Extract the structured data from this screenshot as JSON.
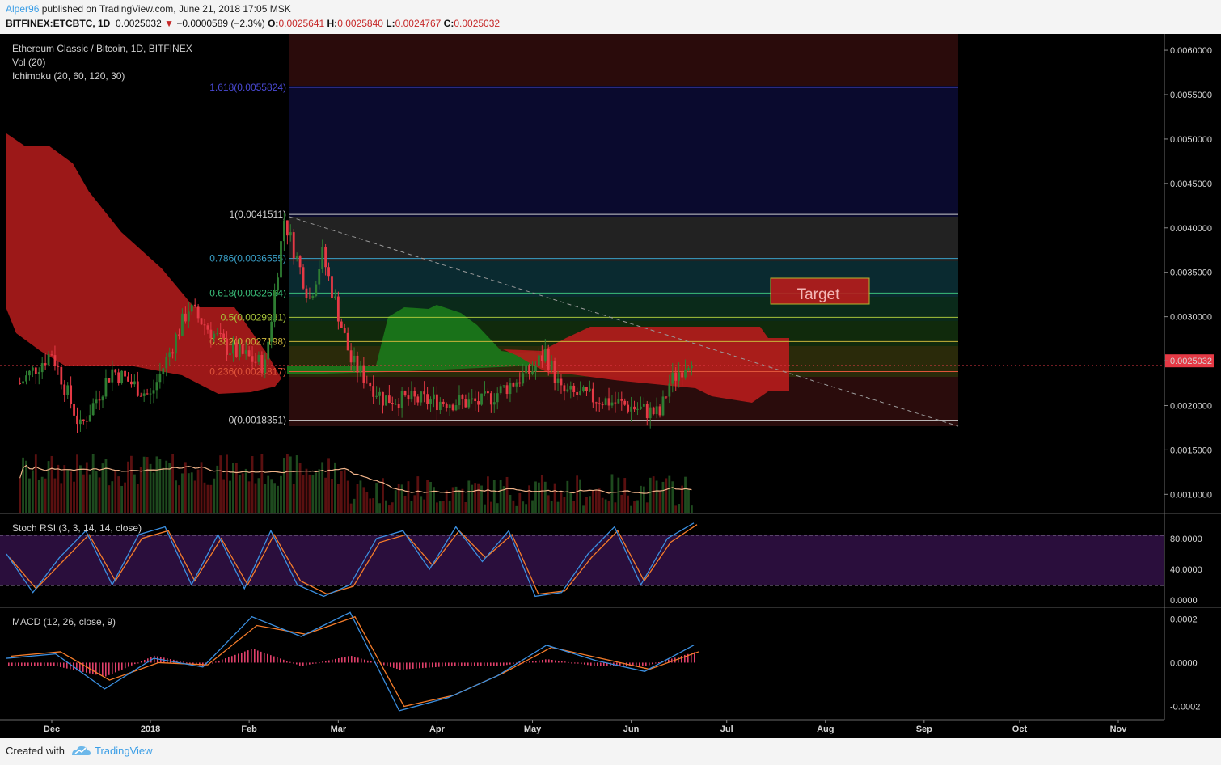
{
  "header": {
    "author": "Alper96",
    "published_text": "published on TradingView.com, June 21, 2018 17:05 MSK",
    "symbol": "BITFINEX:ETCBTC, 1D",
    "last": "0.0025032",
    "change": "−0.0000589 (−2.3%)",
    "o_label": "O:",
    "o": "0.0025641",
    "h_label": "H:",
    "h": "0.0025840",
    "l_label": "L:",
    "l": "0.0024767",
    "c_label": "C:",
    "c": "0.0025032"
  },
  "panes": {
    "main_title": "Ethereum Classic / Bitcoin, 1D, BITFINEX",
    "vol_label": "Vol (20)",
    "ichimoku_label": "Ichimoku (20, 60, 120, 30)",
    "stoch_label": "Stoch RSI (3, 3, 14, 14, close)",
    "macd_label": "MACD (12, 26, close, 9)"
  },
  "annotation": {
    "target_label": "Target"
  },
  "footer": {
    "created_with": "Created with",
    "brand": "TradingView"
  },
  "colors": {
    "background": "#000000",
    "up": "#2e7d32",
    "down": "#e53945",
    "fib_line": "#dcdcdc",
    "cloud_bear": "#b71c1c",
    "cloud_bull": "#1b7a1b",
    "stoch_k": "#3b8fe0",
    "stoch_d": "#f57c2a",
    "macd_line": "#3b8fe0",
    "signal_line": "#f57c2a",
    "current_price_tag": "#e53945"
  },
  "chart_data": [
    {
      "type": "candlestick",
      "title": "Ethereum Classic / Bitcoin, 1D, BITFINEX",
      "x_ticks": [
        "Dec",
        "2018",
        "Feb",
        "Mar",
        "Apr",
        "May",
        "Jun",
        "Jul",
        "Aug",
        "Sep",
        "Oct",
        "Nov"
      ],
      "y_ticks": [
        "0.0060000",
        "0.0055000",
        "0.0050000",
        "0.0045000",
        "0.0040000",
        "0.0035000",
        "0.0030000",
        "0.0025032",
        "0.0020000",
        "0.0015000",
        "0.0010000"
      ],
      "ylim": [
        0.00083,
        0.00611
      ],
      "current_price": 0.0025032,
      "fib_retracement": [
        {
          "label": "1.618(0.0055824)",
          "level": 0.0055824
        },
        {
          "label": "1(0.0041511)",
          "level": 0.0041511
        },
        {
          "label": "0.786(0.0036555)",
          "level": 0.0036555
        },
        {
          "label": "0.618(0.0032664)",
          "level": 0.0032664
        },
        {
          "label": "0.5(0.0029931)",
          "level": 0.0029931
        },
        {
          "label": "0.382(0.0027198)",
          "level": 0.0027198
        },
        {
          "label": "0.236(0.0023817)",
          "level": 0.0023817
        },
        {
          "label": "0(0.0018351)",
          "level": 0.0018351
        }
      ],
      "close_approx": [
        {
          "date": "2017-11-21",
          "close": 0.00225
        },
        {
          "date": "2017-12-01",
          "close": 0.0026
        },
        {
          "date": "2017-12-10",
          "close": 0.00175
        },
        {
          "date": "2017-12-20",
          "close": 0.0024
        },
        {
          "date": "2018-01-01",
          "close": 0.0021
        },
        {
          "date": "2018-01-13",
          "close": 0.0031
        },
        {
          "date": "2018-01-25",
          "close": 0.00265
        },
        {
          "date": "2018-02-06",
          "close": 0.00245
        },
        {
          "date": "2018-02-12",
          "close": 0.0041
        },
        {
          "date": "2018-02-20",
          "close": 0.0032
        },
        {
          "date": "2018-02-24",
          "close": 0.0037
        },
        {
          "date": "2018-03-05",
          "close": 0.0025
        },
        {
          "date": "2018-03-15",
          "close": 0.00208
        },
        {
          "date": "2018-04-01",
          "close": 0.00205
        },
        {
          "date": "2018-04-15",
          "close": 0.00203
        },
        {
          "date": "2018-05-01",
          "close": 0.0024
        },
        {
          "date": "2018-05-05",
          "close": 0.0026
        },
        {
          "date": "2018-05-10",
          "close": 0.00215
        },
        {
          "date": "2018-05-25",
          "close": 0.00205
        },
        {
          "date": "2018-06-10",
          "close": 0.0019
        },
        {
          "date": "2018-06-13",
          "close": 0.00225
        },
        {
          "date": "2018-06-20",
          "close": 0.00256
        },
        {
          "date": "2018-06-21",
          "close": 0.0025032
        }
      ]
    },
    {
      "type": "line",
      "title": "Stoch RSI (3, 3, 14, 14, close)",
      "y_ticks": [
        "80.0000",
        "40.0000",
        "0.0000"
      ],
      "ylim": [
        -5,
        105
      ],
      "band": [
        20,
        80
      ],
      "series": [
        {
          "name": "K",
          "values": [
            60,
            10,
            55,
            90,
            20,
            85,
            95,
            20,
            85,
            15,
            90,
            20,
            5,
            20,
            80,
            90,
            40,
            95,
            50,
            90,
            5,
            10,
            60,
            95,
            20,
            80,
            100
          ]
        },
        {
          "name": "D",
          "values": [
            55,
            15,
            50,
            85,
            25,
            80,
            90,
            25,
            80,
            20,
            85,
            25,
            8,
            18,
            75,
            85,
            45,
            90,
            55,
            85,
            8,
            12,
            55,
            90,
            25,
            75,
            98
          ]
        }
      ]
    },
    {
      "type": "line",
      "title": "MACD (12, 26, close, 9)",
      "y_ticks": [
        "0.0002",
        "0.0000",
        "-0.0002"
      ],
      "ylim": [
        -0.00025,
        0.00022
      ],
      "series": [
        {
          "name": "MACD",
          "values": [
            2e-05,
            4e-05,
            -0.00012,
            2e-05,
            -2e-05,
            0.00021,
            0.00012,
            0.00023,
            -0.00022,
            -0.00016,
            -6e-05,
            8e-05,
            1e-05,
            -4e-05,
            8e-05
          ]
        },
        {
          "name": "Signal",
          "values": [
            3e-05,
            5e-05,
            -8e-05,
            0.0,
            -1e-05,
            0.00017,
            0.00013,
            0.00021,
            -0.0002,
            -0.00015,
            -5e-05,
            7e-05,
            2e-05,
            -3e-05,
            5e-05
          ]
        }
      ]
    }
  ]
}
